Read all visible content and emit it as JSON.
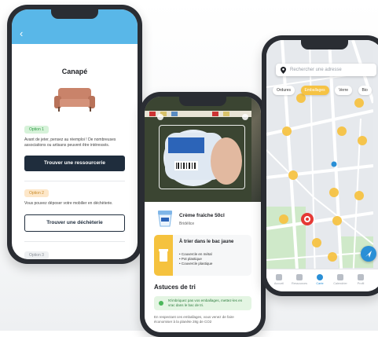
{
  "phone1": {
    "back": "‹",
    "title": "Canapé",
    "option1": {
      "badge": "Option 1",
      "text": "Avant de jeter, pensez au réemploi ! De nombreuses associations ou artisans peuvent être intéressés.",
      "button": "Trouver une ressourcerie"
    },
    "option2": {
      "badge": "Option 2",
      "text": "Vous pouvez déposer votre mobilier en déchèterie.",
      "button": "Trouver une déchèterie"
    },
    "option3": {
      "badge": "Option 3"
    }
  },
  "phone2": {
    "product_name": "Crème fraîche 50cl",
    "product_brand": "Bridélice",
    "bin_title": "À trier dans le bac jaune",
    "bin_items": [
      "• Couvercle en métal",
      "• Pot plastique",
      "• Couvercle plastique"
    ],
    "tips_title": "Astuces de tri",
    "tip1": "N'imbriquez pas vos emballages, mettez-les en vrac dans le bac de tri.",
    "tip2": "En respectant ces emballages, vous venez de faire économiser à la planète 28g de CO2"
  },
  "phone3": {
    "search_placeholder": "Rechercher une adresse",
    "chips": [
      "Ordures",
      "Emballages",
      "Verre",
      "Bio"
    ],
    "tabs": [
      "Accueil",
      "Ressources",
      "Carte",
      "Calendrier",
      "Profil"
    ],
    "accent_yellow": "#f6c344",
    "accent_blue": "#2a8fd6",
    "accent_red": "#e53935"
  }
}
